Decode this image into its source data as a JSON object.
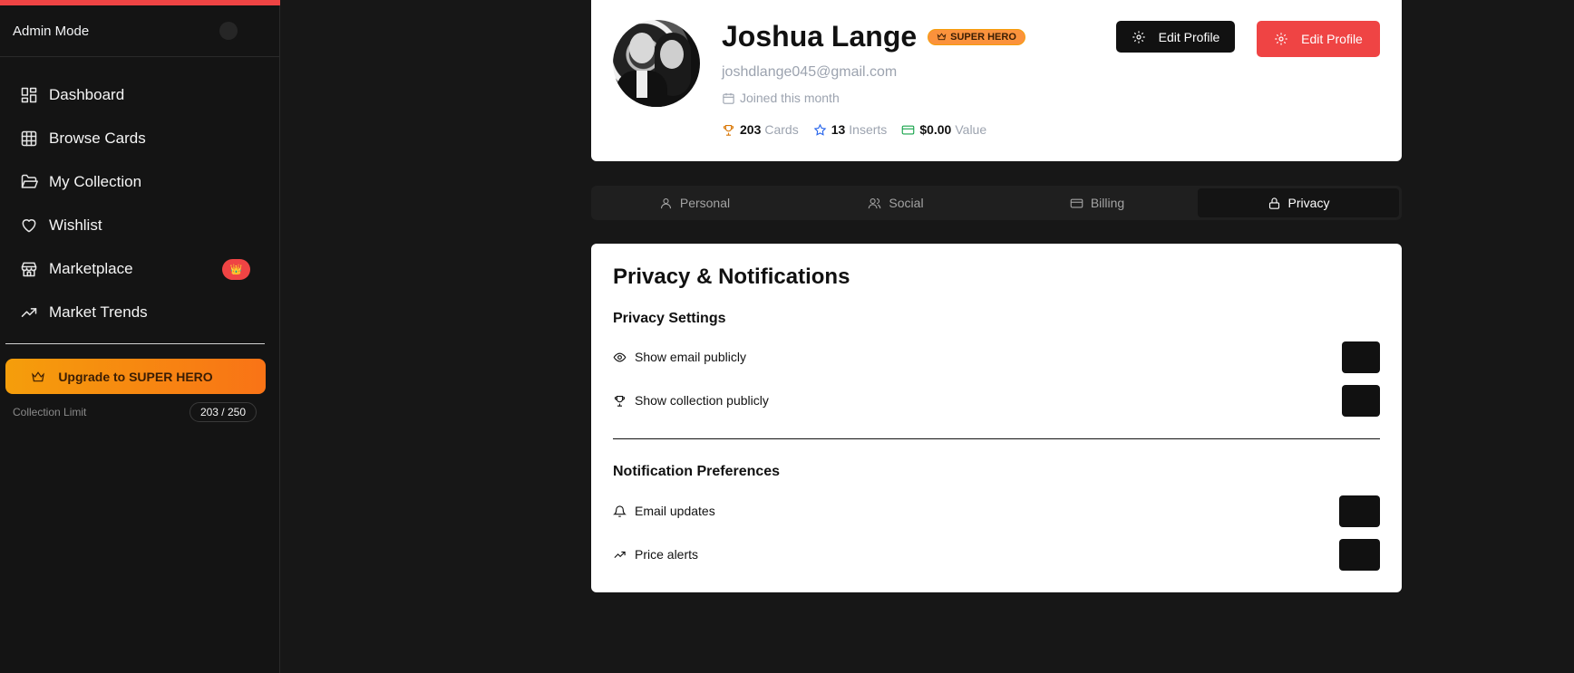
{
  "sidebar": {
    "admin_label": "Admin Mode",
    "items": [
      {
        "label": "Dashboard",
        "icon": "dashboard-icon"
      },
      {
        "label": "Browse Cards",
        "icon": "grid-icon"
      },
      {
        "label": "My Collection",
        "icon": "folder-open-icon"
      },
      {
        "label": "Wishlist",
        "icon": "heart-icon"
      },
      {
        "label": "Marketplace",
        "icon": "store-icon",
        "badge": "👑"
      },
      {
        "label": "Market Trends",
        "icon": "trending-up-icon"
      }
    ],
    "upgrade_label": "Upgrade to SUPER HERO",
    "limit_label": "Collection Limit",
    "limit_value": "203 / 250"
  },
  "profile": {
    "name": "Joshua Lange",
    "badge": "SUPER HERO",
    "email": "joshdlange045@gmail.com",
    "joined": "Joined this month",
    "stats": [
      {
        "value": "203",
        "unit": "Cards",
        "icon": "trophy-icon",
        "color": "#d97706"
      },
      {
        "value": "13",
        "unit": "Inserts",
        "icon": "star-icon",
        "color": "#2563eb"
      },
      {
        "value": "$0.00",
        "unit": "Value",
        "icon": "credit-card-icon",
        "color": "#16a34a"
      }
    ],
    "edit_dark_label": "Edit Profile",
    "edit_red_label": "Edit Profile"
  },
  "tabs": [
    {
      "label": "Personal",
      "icon": "user-icon"
    },
    {
      "label": "Social",
      "icon": "users-icon"
    },
    {
      "label": "Billing",
      "icon": "credit-card-icon"
    },
    {
      "label": "Privacy",
      "icon": "lock-icon",
      "active": true
    }
  ],
  "privacy": {
    "title": "Privacy & Notifications",
    "privacy_heading": "Privacy Settings",
    "show_email": "Show email publicly",
    "show_collection": "Show collection publicly",
    "notif_heading": "Notification Preferences",
    "email_updates": "Email updates",
    "price_alerts": "Price alerts"
  },
  "colors": {
    "accent_red": "#ef4444",
    "upgrade_gradient_start": "#f59e0b",
    "upgrade_gradient_end": "#f97316",
    "background": "#171717"
  }
}
